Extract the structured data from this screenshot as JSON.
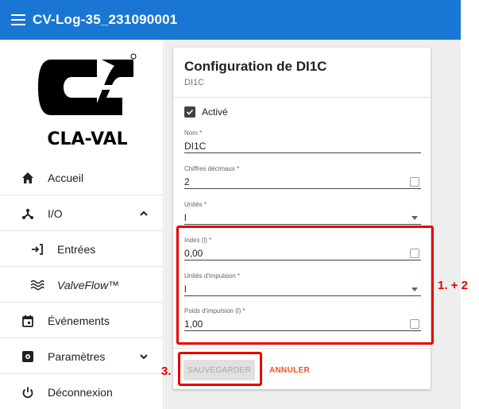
{
  "header": {
    "title": "CV-Log-35_231090001"
  },
  "sidebar": {
    "logo_text": "CLA-VAL",
    "items": [
      {
        "label": "Accueil",
        "icon": "home-icon"
      },
      {
        "label": "I/O",
        "icon": "io-icon",
        "expanded": true
      },
      {
        "label": "Entrées",
        "icon": "input-icon"
      },
      {
        "label": "ValveFlow™",
        "icon": "waves-icon"
      },
      {
        "label": "Événements",
        "icon": "calendar-icon"
      },
      {
        "label": "Paramètres",
        "icon": "settings-icon",
        "expanded": false
      },
      {
        "label": "Déconnexion",
        "icon": "power-icon"
      }
    ]
  },
  "card": {
    "title": "Configuration de DI1C",
    "subtitle": "DI1C",
    "enabled_label": "Activé",
    "enabled": true,
    "fields": {
      "nom": {
        "label": "Nom *",
        "value": "DI1C"
      },
      "decimals": {
        "label": "Chiffres décimaux *",
        "value": "2"
      },
      "units": {
        "label": "Unités *",
        "value": "l"
      },
      "index": {
        "label": "Index (l) *",
        "value": "0,00"
      },
      "pulse_units": {
        "label": "Unités d'impulsion *",
        "value": "l"
      },
      "pulse_weight": {
        "label": "Poids d'impulsion (l) *",
        "value": "1,00"
      }
    },
    "save_label": "SAUVEGARDER",
    "cancel_label": "ANNULER"
  },
  "annotations": {
    "fields": "1. + 2",
    "save": "3."
  },
  "colors": {
    "appbar": "#1976d2",
    "annotation": "#e60000",
    "cancel": "#f4511e"
  }
}
